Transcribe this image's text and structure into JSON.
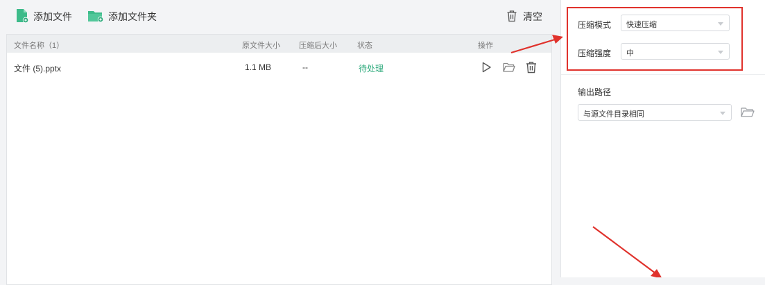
{
  "toolbar": {
    "add_file": "添加文件",
    "add_folder": "添加文件夹",
    "clear": "清空"
  },
  "table": {
    "headers": {
      "name": "文件名称（1）",
      "orig_size": "原文件大小",
      "comp_size": "压缩后大小",
      "status": "状态",
      "actions": "操作"
    },
    "rows": [
      {
        "name": "文件 (5).pptx",
        "orig_size": "1.1 MB",
        "comp_size": "--",
        "status": "待处理"
      }
    ]
  },
  "settings": {
    "mode_label": "压缩模式",
    "mode_value": "快速压缩",
    "strength_label": "压缩强度",
    "strength_value": "中",
    "output_label": "输出路径",
    "output_value": "与源文件目录相同"
  },
  "colors": {
    "accent_green": "#2eaa7c",
    "annotation_red": "#e0322c"
  }
}
